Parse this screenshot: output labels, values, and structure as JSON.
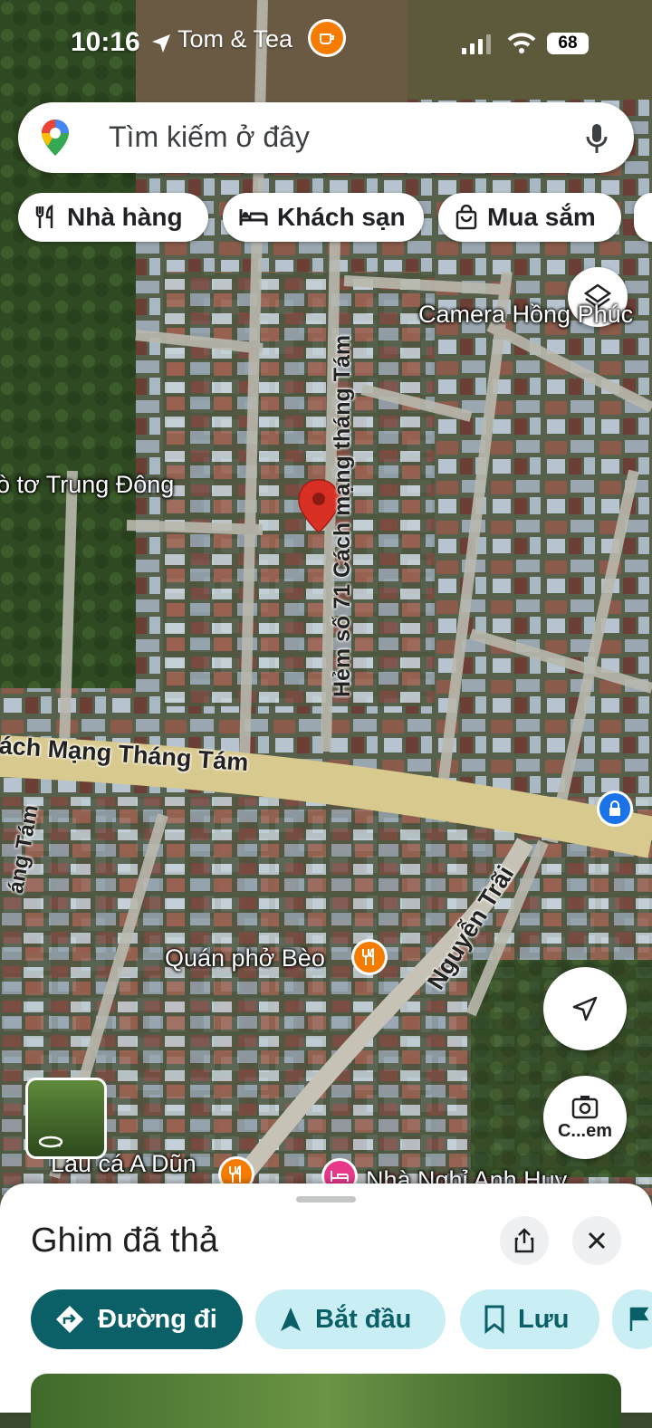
{
  "status_bar": {
    "time": "10:16",
    "place": "Tom & Tea",
    "battery": "68"
  },
  "search": {
    "placeholder": "Tìm kiếm ở đây"
  },
  "chips": [
    {
      "label": "Nhà hàng",
      "icon": "restaurant-icon"
    },
    {
      "label": "Khách sạn",
      "icon": "hotel-icon"
    },
    {
      "label": "Mua sắm",
      "icon": "shopping-bag-icon"
    }
  ],
  "map": {
    "labels": {
      "camera": "Camera Hồng Phúc",
      "trung_dong": "ò tơ Trung Đông",
      "hem": "Hẻm số 71 Cách mạng tháng Tám",
      "main_road": "ách Mạng Tháng Tám",
      "left_road": "áng Tám",
      "nguyen_trai": "Nguyễn Trãi",
      "quan_pho": "Quán phở Bèo",
      "lau_ca": "Lẩu cá A Dũn",
      "nha_nghi": "Nhà Nghỉ Anh Huy",
      "street_view": "C...em"
    },
    "colors": {
      "pin": "#d93025",
      "restaurant_marker": "#f57c00",
      "lodging_marker": "#e8388a",
      "lock_marker": "#1a73e8"
    }
  },
  "sheet": {
    "title": "Ghim đã thả",
    "actions": [
      {
        "label": "Đường đi",
        "icon": "directions-icon"
      },
      {
        "label": "Bắt đầu",
        "icon": "navigation-arrow-icon"
      },
      {
        "label": "Lưu",
        "icon": "bookmark-icon"
      }
    ]
  }
}
